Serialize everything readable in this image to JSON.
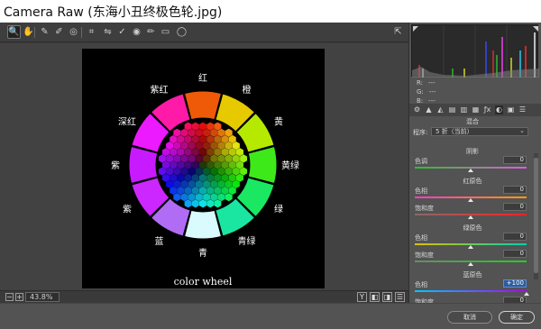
{
  "window": {
    "title": "Camera Raw (东海小丑终极色轮.jpg)"
  },
  "toolbar": {
    "tools": [
      {
        "name": "zoom-tool-icon",
        "glyph": "🔍",
        "active": true
      },
      {
        "name": "hand-tool-icon",
        "glyph": "✋",
        "active": false
      },
      {
        "name": "white-balance-tool-icon",
        "glyph": "✎",
        "active": false
      },
      {
        "name": "color-sampler-tool-icon",
        "glyph": "✐",
        "active": false
      },
      {
        "name": "targeted-adjustment-tool-icon",
        "glyph": "◎",
        "active": false
      },
      {
        "name": "crop-tool-icon",
        "glyph": "⌗",
        "active": false
      },
      {
        "name": "straighten-tool-icon",
        "glyph": "⇋",
        "active": false
      },
      {
        "name": "spot-removal-tool-icon",
        "glyph": "✓",
        "active": false
      },
      {
        "name": "red-eye-tool-icon",
        "glyph": "◉",
        "active": false
      },
      {
        "name": "adjustment-brush-icon",
        "glyph": "✏",
        "active": false
      },
      {
        "name": "graduated-filter-icon",
        "glyph": "▭",
        "active": false
      },
      {
        "name": "radial-filter-icon",
        "glyph": "◯",
        "active": false
      }
    ],
    "export_icon": "⇱"
  },
  "image": {
    "wheel_labels": [
      "红",
      "橙",
      "黄",
      "黄绿",
      "绿",
      "青绿",
      "青",
      "蓝",
      "紫",
      "紫",
      "深红",
      "紫红"
    ],
    "caption": "color wheel",
    "segment_colors": [
      "#ee5a08",
      "#e7c900",
      "#b5ea00",
      "#3ee91a",
      "#1ae862",
      "#1ae6a2",
      "#d9fbfd",
      "#b16cf6",
      "#cc27ff",
      "#c81aff",
      "#ec1aff",
      "#ff1aa8"
    ]
  },
  "status": {
    "zoom": "43.8%",
    "zoom_out": "−",
    "zoom_in": "+",
    "view_btns": [
      "Y",
      "◧",
      "◨",
      "☰"
    ]
  },
  "histogram": {
    "rgb_rows": [
      {
        "k": "R:",
        "v": "---"
      },
      {
        "k": "G:",
        "v": "---"
      },
      {
        "k": "B:",
        "v": "---"
      }
    ]
  },
  "panel_tabs": [
    "⚙",
    "▲",
    "◭",
    "▤",
    "▥",
    "▦",
    "ƒx",
    "◐",
    "▣",
    "☰"
  ],
  "hsl": {
    "title": "混合",
    "method_label": "程序:",
    "method_value": "5 折（当前）",
    "sections": [
      {
        "title": "阴影",
        "params": [
          {
            "label": "色调",
            "value": "0"
          }
        ]
      },
      {
        "title": "红原色",
        "params": [
          {
            "label": "色相",
            "value": "0"
          },
          {
            "label": "饱和度",
            "value": "0"
          }
        ]
      },
      {
        "title": "绿原色",
        "params": [
          {
            "label": "色相",
            "value": "0"
          },
          {
            "label": "饱和度",
            "value": "0"
          }
        ]
      },
      {
        "title": "蓝原色",
        "params": [
          {
            "label": "色相",
            "value": "+100"
          },
          {
            "label": "饱和度",
            "value": "0"
          }
        ]
      }
    ]
  },
  "footer": {
    "cancel": "取消",
    "ok": "确定"
  }
}
